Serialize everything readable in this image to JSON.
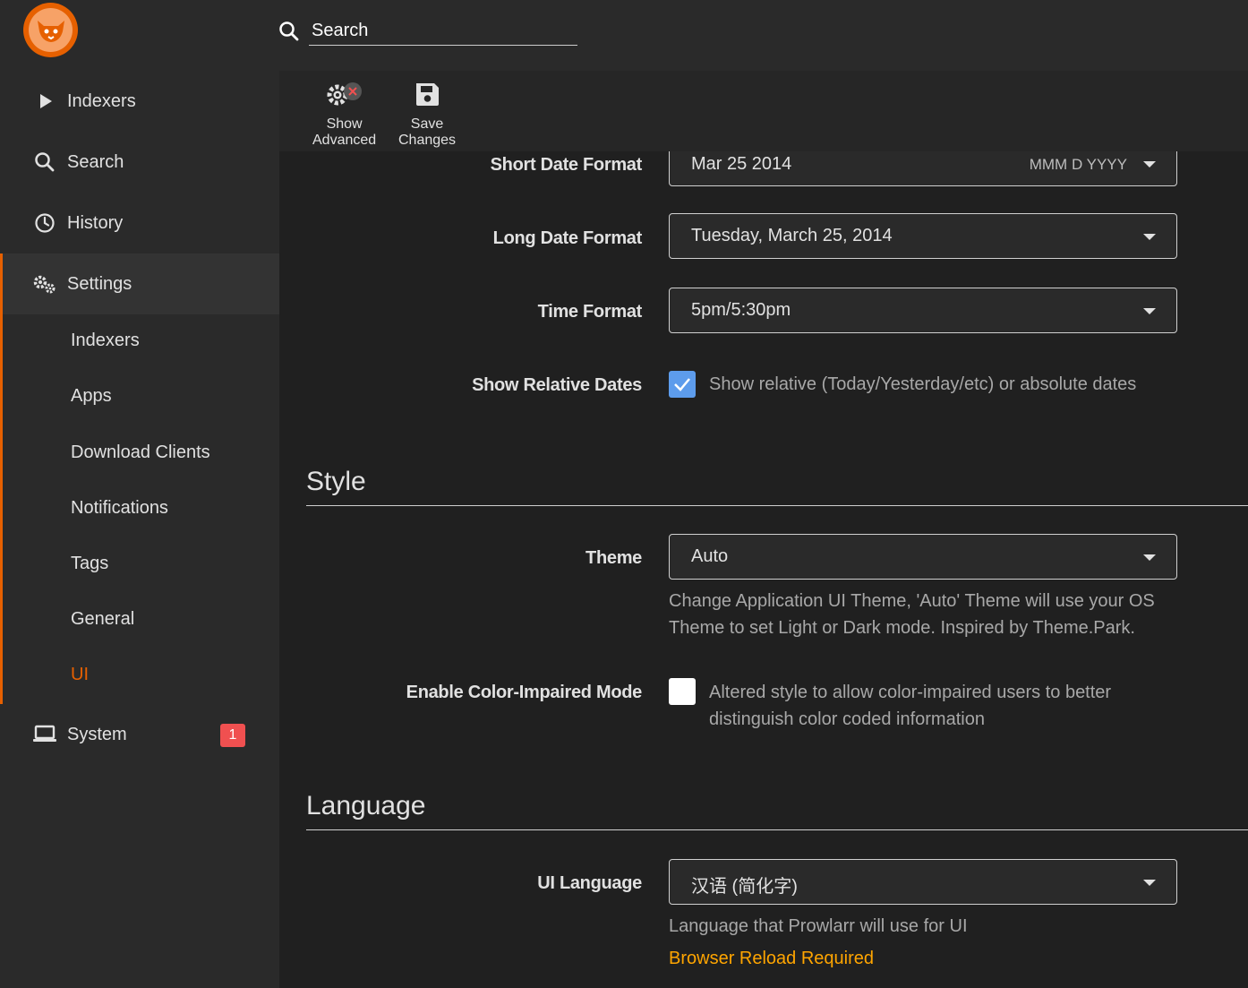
{
  "header": {
    "search": {
      "placeholder": "Search",
      "value": ""
    }
  },
  "sidebar": {
    "items": [
      {
        "label": "Indexers",
        "icon": "play-icon"
      },
      {
        "label": "Search",
        "icon": "search-icon"
      },
      {
        "label": "History",
        "icon": "clock-icon"
      },
      {
        "label": "Settings",
        "icon": "gears-icon"
      },
      {
        "label": "System",
        "icon": "laptop-icon",
        "badge": "1"
      }
    ],
    "settings_sub": [
      "Indexers",
      "Apps",
      "Download Clients",
      "Notifications",
      "Tags",
      "General",
      "UI"
    ],
    "active_sub": "UI"
  },
  "toolbar": {
    "show_advanced": {
      "line1": "Show",
      "line2": "Advanced"
    },
    "save_changes": {
      "line1": "Save",
      "line2": "Changes"
    }
  },
  "dates": {
    "short_date": {
      "label": "Short Date Format",
      "value": "Mar 25 2014",
      "hint": "MMM D YYYY"
    },
    "long_date": {
      "label": "Long Date Format",
      "value": "Tuesday, March 25, 2014"
    },
    "time_format": {
      "label": "Time Format",
      "value": "5pm/5:30pm"
    },
    "relative_dates": {
      "label": "Show Relative Dates",
      "checked": true,
      "help": "Show relative (Today/Yesterday/etc) or absolute dates"
    }
  },
  "style": {
    "legend": "Style",
    "theme": {
      "label": "Theme",
      "value": "Auto",
      "help_line1": "Change Application UI Theme, 'Auto' Theme will use your OS",
      "help_line2": "Theme to set Light or Dark mode. Inspired by Theme.Park."
    },
    "color_impaired": {
      "label": "Enable Color-Impaired Mode",
      "checked": false,
      "help_line1": "Altered style to allow color-impaired users to better",
      "help_line2": "distinguish color coded information"
    }
  },
  "language": {
    "legend": "Language",
    "ui_language": {
      "label": "UI Language",
      "value": "汉语 (简化字)",
      "help": "Language that Prowlarr will use for UI",
      "warning": "Browser Reload Required"
    }
  },
  "colors": {
    "accent": "#e66000",
    "checkbox": "#5d9cec",
    "badge": "#f05050",
    "warning": "#ffa500"
  }
}
